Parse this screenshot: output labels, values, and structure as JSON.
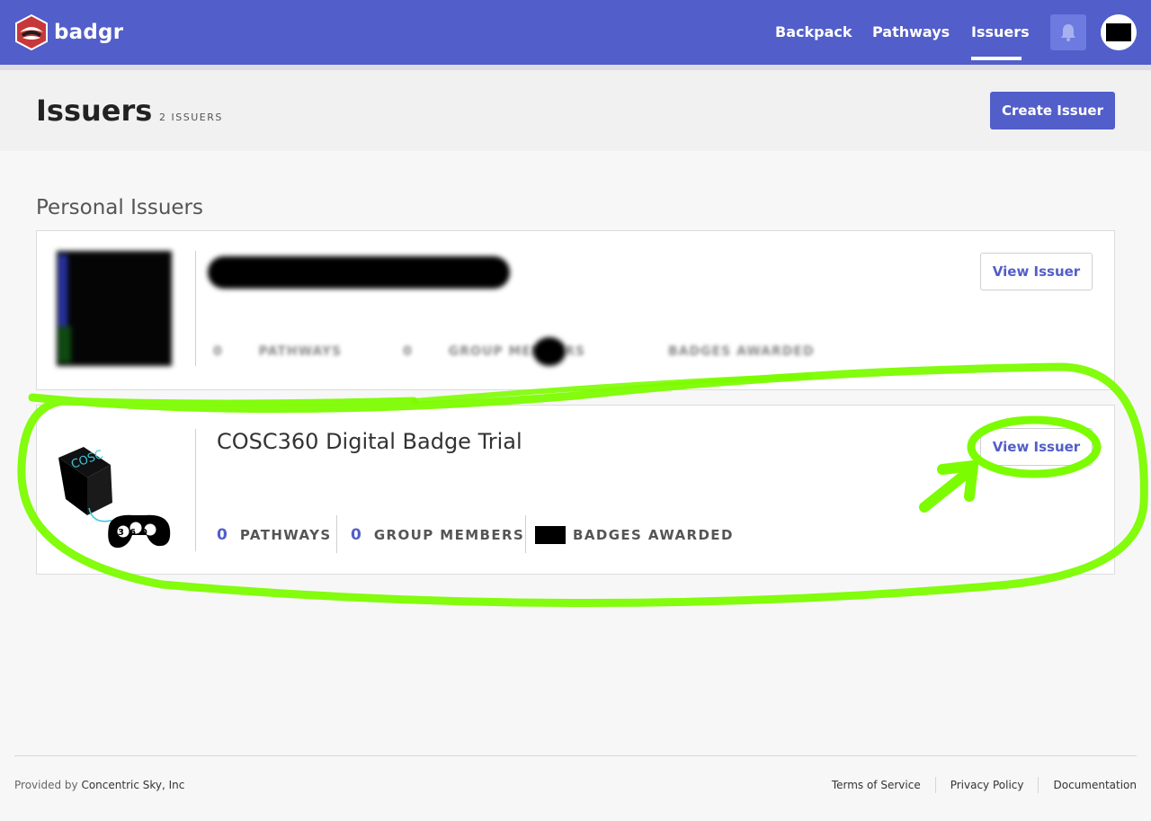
{
  "nav": {
    "brand": "badgr",
    "links": [
      "Backpack",
      "Pathways",
      "Issuers"
    ],
    "active": "Issuers"
  },
  "header": {
    "title": "Issuers",
    "count": "2 ISSUERS",
    "create_button": "Create Issuer"
  },
  "section": {
    "title": "Personal Issuers"
  },
  "issuers": [
    {
      "name": "[redacted]",
      "view_button": "View Issuer",
      "stats": {
        "pathways_num": "0",
        "pathways_label": "PATHWAYS",
        "members_num": "0",
        "members_label": "GROUP MEMBERS",
        "badges_label": "BADGES AWARDED"
      }
    },
    {
      "name": "COSC360 Digital Badge Trial",
      "view_button": "View Issuer",
      "logo_text_top": "COSC",
      "logo_text_bottom": "360",
      "stats": {
        "pathways_num": "0",
        "pathways_label": "PATHWAYS",
        "members_num": "0",
        "members_label": "GROUP MEMBERS",
        "badges_label": "BADGES AWARDED"
      }
    }
  ],
  "footer": {
    "provided_by": "Provided by",
    "company": "Concentric Sky, Inc",
    "links": [
      "Terms of Service",
      "Privacy Policy",
      "Documentation"
    ]
  },
  "colors": {
    "brand": "#525ec9",
    "annotation": "#7cfc00"
  },
  "icons": {
    "logo": "badgr-logo-icon",
    "bell": "bell-icon"
  }
}
